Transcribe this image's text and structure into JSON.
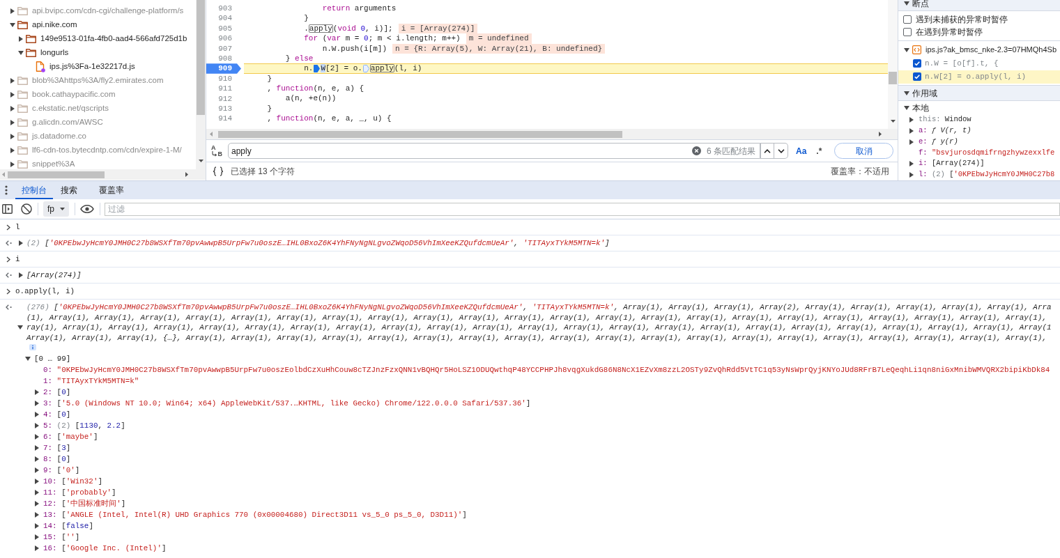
{
  "file_tree": {
    "items": [
      {
        "kind": "folder",
        "label": "api.bvipc.com/cdn-cgi/challenge-platform/s",
        "expanded": false,
        "dimmed": true
      },
      {
        "kind": "folder",
        "label": "api.nike.com",
        "expanded": true,
        "dimmed": false,
        "children": [
          {
            "kind": "folder",
            "label": "149e9513-01fa-4fb0-aad4-566afd725d1b",
            "expanded": false,
            "dimmed": false
          },
          {
            "kind": "folder",
            "label": "longurls",
            "expanded": true,
            "dimmed": false,
            "children": [
              {
                "kind": "file",
                "label": "ips.js%3Fa-1e32217d.js",
                "dimmed": false
              }
            ]
          }
        ]
      },
      {
        "kind": "folder",
        "label": "blob%3Ahttps%3A/fly2.emirates.com",
        "expanded": false,
        "dimmed": true
      },
      {
        "kind": "folder",
        "label": "book.cathaypacific.com",
        "expanded": false,
        "dimmed": true
      },
      {
        "kind": "folder",
        "label": "c.ekstatic.net/qscripts",
        "expanded": false,
        "dimmed": true
      },
      {
        "kind": "folder",
        "label": "g.alicdn.com/AWSC",
        "expanded": false,
        "dimmed": true
      },
      {
        "kind": "folder",
        "label": "js.datadome.co",
        "expanded": false,
        "dimmed": true
      },
      {
        "kind": "folder",
        "label": "lf6-cdn-tos.bytecdntp.com/cdn/expire-1-M/",
        "expanded": false,
        "dimmed": true
      },
      {
        "kind": "folder",
        "label": "snippet%3A",
        "expanded": false,
        "dimmed": true
      }
    ]
  },
  "editor": {
    "lines": [
      {
        "number": "903",
        "breakpoint": false,
        "paused": false,
        "tokens": [
          {
            "kind": "keyword",
            "text": "                return"
          },
          {
            "kind": "plain",
            "text": " arguments"
          }
        ]
      },
      {
        "number": "904",
        "breakpoint": false,
        "paused": false,
        "tokens": [
          {
            "kind": "plain",
            "text": "            }"
          }
        ]
      },
      {
        "number": "905",
        "breakpoint": false,
        "paused": false,
        "tokens": [
          {
            "kind": "plain",
            "text": "            ."
          },
          {
            "kind": "match",
            "text": "apply"
          },
          {
            "kind": "plain",
            "text": "("
          },
          {
            "kind": "keyword",
            "text": "void"
          },
          {
            "kind": "number",
            "text": " 0"
          },
          {
            "kind": "plain",
            "text": ", i)];"
          }
        ],
        "inline_value": "i = [Array(274)]"
      },
      {
        "number": "906",
        "breakpoint": false,
        "paused": false,
        "tokens": [
          {
            "kind": "keyword",
            "text": "            for"
          },
          {
            "kind": "plain",
            "text": " ("
          },
          {
            "kind": "keyword",
            "text": "var"
          },
          {
            "kind": "plain",
            "text": " m = "
          },
          {
            "kind": "number",
            "text": "0"
          },
          {
            "kind": "plain",
            "text": "; m < i.length; m++)"
          }
        ],
        "inline_value": "m = undefined"
      },
      {
        "number": "907",
        "breakpoint": false,
        "paused": false,
        "tokens": [
          {
            "kind": "plain",
            "text": "                n.W.push(i[m])"
          }
        ],
        "inline_value": "n = {R: Array(5), W: Array(21), B: undefined}"
      },
      {
        "number": "908",
        "breakpoint": false,
        "paused": false,
        "tokens": [
          {
            "kind": "plain",
            "text": "        } "
          },
          {
            "kind": "keyword",
            "text": "else"
          }
        ]
      },
      {
        "number": "909",
        "breakpoint": true,
        "paused": true,
        "tokens": [
          {
            "kind": "plain",
            "text": "            n."
          },
          {
            "kind": "inline_breakpoint",
            "active": true
          },
          {
            "kind": "selection",
            "text": "W"
          },
          {
            "kind": "plain",
            "text": "[2] = o."
          },
          {
            "kind": "inline_breakpoint",
            "active": false
          },
          {
            "kind": "match",
            "text": "apply"
          },
          {
            "kind": "plain",
            "text": "(l, i)"
          }
        ]
      },
      {
        "number": "910",
        "breakpoint": false,
        "paused": false,
        "tokens": [
          {
            "kind": "plain",
            "text": "    }"
          }
        ]
      },
      {
        "number": "911",
        "breakpoint": false,
        "paused": false,
        "tokens": [
          {
            "kind": "plain",
            "text": "    , "
          },
          {
            "kind": "keyword",
            "text": "function"
          },
          {
            "kind": "plain",
            "text": "(n, e, a) {"
          }
        ]
      },
      {
        "number": "912",
        "breakpoint": false,
        "paused": false,
        "tokens": [
          {
            "kind": "plain",
            "text": "        a(n, +e(n))"
          }
        ]
      },
      {
        "number": "913",
        "breakpoint": false,
        "paused": false,
        "tokens": [
          {
            "kind": "plain",
            "text": "    }"
          }
        ]
      },
      {
        "number": "914",
        "breakpoint": false,
        "paused": false,
        "tokens": [
          {
            "kind": "plain",
            "text": "    , "
          },
          {
            "kind": "keyword",
            "text": "function"
          },
          {
            "kind": "plain",
            "text": "(n, e, a, _, u) {"
          }
        ]
      }
    ]
  },
  "search": {
    "replace_from": "A",
    "replace_to": "B",
    "query": "apply",
    "match_count": "6 条匹配结果",
    "case_label": "Aa",
    "regex_label": ".*",
    "cancel_label": "取消"
  },
  "status_bar": {
    "selection": "已选择 13 个字符",
    "coverage": "覆盖率：不适用"
  },
  "breakpoints": {
    "title": "断点",
    "expanded": true,
    "options": [
      {
        "label": "遇到未捕获的异常时暂停",
        "checked": false
      },
      {
        "label": "在遇到异常时暂停",
        "checked": false
      }
    ],
    "files": [
      {
        "name": "ips.js?ak_bmsc_nke-2.3=07HMQh4Sb",
        "expanded": true,
        "items": [
          {
            "code": "n.W = [o[f].t, {",
            "checked": true,
            "selected": false
          },
          {
            "code": "n.W[2] = o.apply(l, i)",
            "checked": true,
            "selected": true
          }
        ]
      }
    ]
  },
  "scope": {
    "title": "作用域",
    "expanded": true,
    "groups": [
      {
        "title": "本地",
        "expanded": true,
        "variables": [
          {
            "expanded": false,
            "tokens": [
              {
                "kind": "key_dim",
                "text": "this:"
              },
              {
                "kind": "plain",
                "text": " Window"
              }
            ]
          },
          {
            "expanded": false,
            "tokens": [
              {
                "kind": "key",
                "text": "a:"
              },
              {
                "kind": "function",
                "text": " ƒ V(r, t)"
              }
            ]
          },
          {
            "expanded": false,
            "tokens": [
              {
                "kind": "key",
                "text": "e:"
              },
              {
                "kind": "function",
                "text": " ƒ y(r)"
              }
            ]
          },
          {
            "tokens": [
              {
                "kind": "key",
                "text": "f:"
              },
              {
                "kind": "string",
                "text": " \"bsvjurosdqmifrngzhywzexxlfe"
              }
            ]
          },
          {
            "expanded": false,
            "tokens": [
              {
                "kind": "key",
                "text": "i:"
              },
              {
                "kind": "plain",
                "text": " [Array(274)]"
              }
            ]
          },
          {
            "expanded": false,
            "tokens": [
              {
                "kind": "key",
                "text": "l:"
              },
              {
                "kind": "count",
                "text": " (2)"
              },
              {
                "kind": "plain",
                "text": " ["
              },
              {
                "kind": "string",
                "text": "'0KPEbwJyHcmY0JMH0C27b8"
              }
            ]
          }
        ]
      }
    ]
  },
  "console": {
    "tabs": [
      {
        "label": "控制台",
        "selected": true
      },
      {
        "label": "搜索",
        "selected": false
      },
      {
        "label": "覆盖率",
        "selected": false
      }
    ],
    "context": "fp",
    "filter_placeholder": "过滤",
    "messages": [
      {
        "kind": "input",
        "text": "l"
      },
      {
        "kind": "result",
        "expanded": false,
        "lines": [
          {
            "tokens": [
              {
                "kind": "count",
                "text": "(2) "
              },
              {
                "kind": "plain",
                "text": "["
              },
              {
                "kind": "string",
                "text": "'0KPEbwJyHcmY0JMH0C27b8WSXfTm70pvAwwpB5UrpFw7u0oszE…IHL0BxoZ6K4YhFNyNgNLgvoZWqoD56VhImXeeKZQufdcmUeAr'"
              },
              {
                "kind": "plain",
                "text": ", "
              },
              {
                "kind": "string",
                "text": "'TITAyxTYkM5MTN=k'"
              },
              {
                "kind": "plain",
                "text": "]"
              }
            ]
          }
        ]
      },
      {
        "kind": "input",
        "text": "i"
      },
      {
        "kind": "result",
        "expanded": false,
        "lines": [
          {
            "tokens": [
              {
                "kind": "plain",
                "text": "[Array(274)]"
              }
            ]
          }
        ]
      },
      {
        "kind": "input",
        "text": "o.apply(l, i)"
      },
      {
        "kind": "result",
        "expanded": true,
        "lines": [
          {
            "tokens": [
              {
                "kind": "count",
                "text": "(276) "
              },
              {
                "kind": "plain",
                "text": "["
              },
              {
                "kind": "string",
                "text": "'0KPEbwJyHcmY0JMH0C27b8WSXfTm70pvAwwpB5UrpFw7u0oszE…IHL0BxoZ6K4YhFNyNgNLgvoZWqoD56VhImXeeKZQufdcmUeAr'"
              },
              {
                "kind": "plain",
                "text": ", "
              },
              {
                "kind": "string",
                "text": "'TITAyxTYkM5MTN=k'"
              },
              {
                "kind": "plain",
                "text": ", Array(1), Array(1), Array(1), Array(2), Array(1), Array(1), Array(1), Array(1), Array(1), Arra"
              }
            ]
          },
          {
            "tokens": [
              {
                "kind": "plain",
                "text": "(1), Array(1), Array(1), Array(1), Array(1), Array(1), Array(1), Array(1), Array(1), Array(1), Array(1), Array(1), Array(1), Array(1), Array(1), Array(1), Array(1), Array(1), Array(1), Array(1), Array(1), Array(1), Array(1),"
              }
            ]
          },
          {
            "tokens": [
              {
                "kind": "plain",
                "text": "ray(1), Array(1), Array(1), Array(1), Array(1), Array(1), Array(1), Array(1), Array(1), Array(1), Array(1), Array(1), Array(1), Array(1), Array(1), Array(1), Array(1), Array(1), Array(1), Array(1), Array(1), Array(1), Array(1"
              }
            ]
          },
          {
            "tokens": [
              {
                "kind": "plain",
                "text": "Array(1), Array(1), Array(1), {…}, Array(1), Array(1), Array(1), Array(1), Array(1), Array(1), Array(1), Array(1), Array(1), Array(1), Array(1), Array(1), Array(1), Array(1), Array(1), Array(1), Array(1), Array(1), Array(1),"
              }
            ]
          }
        ],
        "children": [
          {
            "expanded": true,
            "tokens": [
              {
                "kind": "plain",
                "text": "[0 … 99]"
              }
            ],
            "children": [
              {
                "tokens": [
                  {
                    "kind": "key",
                    "text": "0:"
                  },
                  {
                    "kind": "string",
                    "text": " \"0KPEbwJyHcmY0JMH0C27b8WSXfTm70pvAwwpB5UrpFw7u0oszEolbdCzXuHhCouw8cTZJnzFzxQNN1vBQHQr5HoLSZ1ODUQwthqP48YCCPHPJh8vqgXukdG86N8NcX1EZvXm8zzL2OSTy9ZvQhRdd5VtTC1q53yNsWprQyjKNYoJUd8RFrB7LeQeqhLi1qn8niGxMnibWMVQRX2bipiKbDk84"
                  }
                ]
              },
              {
                "tokens": [
                  {
                    "kind": "key",
                    "text": "1:"
                  },
                  {
                    "kind": "string",
                    "text": " \"TITAyxTYkM5MTN=k\""
                  }
                ]
              },
              {
                "expanded": false,
                "tokens": [
                  {
                    "kind": "key",
                    "text": "2:"
                  },
                  {
                    "kind": "plain",
                    "text": " ["
                  },
                  {
                    "kind": "number",
                    "text": "0"
                  },
                  {
                    "kind": "plain",
                    "text": "]"
                  }
                ]
              },
              {
                "expanded": false,
                "tokens": [
                  {
                    "kind": "key",
                    "text": "3:"
                  },
                  {
                    "kind": "plain",
                    "text": " ["
                  },
                  {
                    "kind": "string",
                    "text": "'5.0 (Windows NT 10.0; Win64; x64) AppleWebKit/537.…KHTML, like Gecko) Chrome/122.0.0.0 Safari/537.36'"
                  },
                  {
                    "kind": "plain",
                    "text": "]"
                  }
                ]
              },
              {
                "expanded": false,
                "tokens": [
                  {
                    "kind": "key",
                    "text": "4:"
                  },
                  {
                    "kind": "plain",
                    "text": " ["
                  },
                  {
                    "kind": "number",
                    "text": "0"
                  },
                  {
                    "kind": "plain",
                    "text": "]"
                  }
                ]
              },
              {
                "expanded": false,
                "tokens": [
                  {
                    "kind": "key",
                    "text": "5:"
                  },
                  {
                    "kind": "count",
                    "text": " (2)"
                  },
                  {
                    "kind": "plain",
                    "text": " ["
                  },
                  {
                    "kind": "number",
                    "text": "1130"
                  },
                  {
                    "kind": "plain",
                    "text": ", "
                  },
                  {
                    "kind": "number",
                    "text": "2.2"
                  },
                  {
                    "kind": "plain",
                    "text": "]"
                  }
                ]
              },
              {
                "expanded": false,
                "tokens": [
                  {
                    "kind": "key",
                    "text": "6:"
                  },
                  {
                    "kind": "plain",
                    "text": " ["
                  },
                  {
                    "kind": "string",
                    "text": "'maybe'"
                  },
                  {
                    "kind": "plain",
                    "text": "]"
                  }
                ]
              },
              {
                "expanded": false,
                "tokens": [
                  {
                    "kind": "key",
                    "text": "7:"
                  },
                  {
                    "kind": "plain",
                    "text": " ["
                  },
                  {
                    "kind": "number",
                    "text": "3"
                  },
                  {
                    "kind": "plain",
                    "text": "]"
                  }
                ]
              },
              {
                "expanded": false,
                "tokens": [
                  {
                    "kind": "key",
                    "text": "8:"
                  },
                  {
                    "kind": "plain",
                    "text": " ["
                  },
                  {
                    "kind": "number",
                    "text": "0"
                  },
                  {
                    "kind": "plain",
                    "text": "]"
                  }
                ]
              },
              {
                "expanded": false,
                "tokens": [
                  {
                    "kind": "key",
                    "text": "9:"
                  },
                  {
                    "kind": "plain",
                    "text": " ["
                  },
                  {
                    "kind": "string",
                    "text": "'0'"
                  },
                  {
                    "kind": "plain",
                    "text": "]"
                  }
                ]
              },
              {
                "expanded": false,
                "tokens": [
                  {
                    "kind": "key",
                    "text": "10:"
                  },
                  {
                    "kind": "plain",
                    "text": " ["
                  },
                  {
                    "kind": "string",
                    "text": "'Win32'"
                  },
                  {
                    "kind": "plain",
                    "text": "]"
                  }
                ]
              },
              {
                "expanded": false,
                "tokens": [
                  {
                    "kind": "key",
                    "text": "11:"
                  },
                  {
                    "kind": "plain",
                    "text": " ["
                  },
                  {
                    "kind": "string",
                    "text": "'probably'"
                  },
                  {
                    "kind": "plain",
                    "text": "]"
                  }
                ]
              },
              {
                "expanded": false,
                "tokens": [
                  {
                    "kind": "key",
                    "text": "12:"
                  },
                  {
                    "kind": "plain",
                    "text": " ["
                  },
                  {
                    "kind": "string",
                    "text": "'中国标准时间'"
                  },
                  {
                    "kind": "plain",
                    "text": "]"
                  }
                ]
              },
              {
                "expanded": false,
                "tokens": [
                  {
                    "kind": "key",
                    "text": "13:"
                  },
                  {
                    "kind": "plain",
                    "text": " ["
                  },
                  {
                    "kind": "string",
                    "text": "'ANGLE (Intel, Intel(R) UHD Graphics 770 (0x00004680) Direct3D11 vs_5_0 ps_5_0, D3D11)'"
                  },
                  {
                    "kind": "plain",
                    "text": "]"
                  }
                ]
              },
              {
                "expanded": false,
                "tokens": [
                  {
                    "kind": "key",
                    "text": "14:"
                  },
                  {
                    "kind": "plain",
                    "text": " ["
                  },
                  {
                    "kind": "boolean",
                    "text": "false"
                  },
                  {
                    "kind": "plain",
                    "text": "]"
                  }
                ]
              },
              {
                "expanded": false,
                "tokens": [
                  {
                    "kind": "key",
                    "text": "15:"
                  },
                  {
                    "kind": "plain",
                    "text": " ["
                  },
                  {
                    "kind": "string",
                    "text": "''"
                  },
                  {
                    "kind": "plain",
                    "text": "]"
                  }
                ]
              },
              {
                "expanded": false,
                "tokens": [
                  {
                    "kind": "key",
                    "text": "16:"
                  },
                  {
                    "kind": "plain",
                    "text": " ["
                  },
                  {
                    "kind": "string",
                    "text": "'Google Inc. (Intel)'"
                  },
                  {
                    "kind": "plain",
                    "text": "]"
                  }
                ]
              }
            ]
          }
        ]
      }
    ]
  }
}
